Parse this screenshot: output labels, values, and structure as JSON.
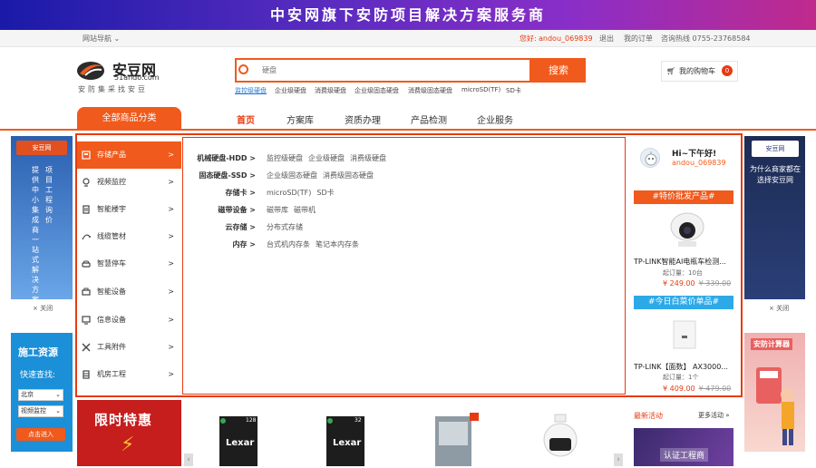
{
  "banner": {
    "text": "中安网旗下安防项目解决方案服务商"
  },
  "topbar": {
    "site_nav": "网站导航",
    "greeting": "您好:",
    "username": "andou_069839",
    "logout": "退出",
    "my_orders": "我的订单",
    "hotline": "咨询热线 0755-23768584"
  },
  "logo": {
    "cn": "安豆网",
    "en": "51ando.com",
    "slogan": "安防集采找安豆"
  },
  "search": {
    "placeholder": "硬盘",
    "button": "搜索",
    "hot_keywords": [
      "监控级硬盘",
      "企业级硬盘",
      "消费级硬盘",
      "企业级固态硬盘",
      "消费级固态硬盘",
      "microSD(TF)",
      "SD卡"
    ]
  },
  "cart": {
    "label": "我的购物车",
    "count": "0"
  },
  "nav": {
    "all_categories": "全部商品分类",
    "items": [
      "首页",
      "方案库",
      "资质办理",
      "产品检测",
      "企业服务"
    ]
  },
  "categories": [
    "存储产品",
    "视频监控",
    "智能楼宇",
    "线缆管材",
    "智慧停车",
    "智能设备",
    "信息设备",
    "工具附件",
    "机房工程"
  ],
  "subcategories": [
    {
      "name": "机械硬盘-HDD >",
      "links": [
        "监控级硬盘",
        "企业级硬盘",
        "消费级硬盘"
      ]
    },
    {
      "name": "固态硬盘-SSD >",
      "links": [
        "企业级固态硬盘",
        "消费级固态硬盘"
      ]
    },
    {
      "name": "存储卡 >",
      "links": [
        "microSD(TF)",
        "SD卡"
      ]
    },
    {
      "name": "磁带设备 >",
      "links": [
        "磁带库",
        "磁带机"
      ]
    },
    {
      "name": "云存储 >",
      "links": [
        "分布式存储"
      ]
    },
    {
      "name": "内存 >",
      "links": [
        "台式机内存条",
        "笔记本内存条"
      ]
    }
  ],
  "user_panel": {
    "greeting": "Hi~下午好!",
    "username": "andou_069839"
  },
  "promo1": {
    "title": "#特价批发产品#",
    "name": "TP-LINK智能AI电瓶车检测...",
    "meta": "起订量：10台",
    "price": "¥ 249.00",
    "old_price": "¥ 339.00"
  },
  "promo2": {
    "title": "#今日白菜价单品#",
    "name": "TP-LINK【面数】 AX3000...",
    "meta": "起订量：1个",
    "price": "¥ 409.00",
    "old_price": "¥ 479.00"
  },
  "ad_left": {
    "logo": "安豆网",
    "col1": "提供中小集成商一站式解决方案",
    "col2": "项目工程询价",
    "close": "× 关闭"
  },
  "ad_right": {
    "logo": "安豆网",
    "text": "为什么商家都在选择安豆网",
    "close": "× 关闭"
  },
  "ad_resource": {
    "title": "施工资源",
    "subtitle": "快速查找:",
    "select1": "北京",
    "select2": "视频监控",
    "button": "点击进入"
  },
  "ad_calc": {
    "title": "安防计算器"
  },
  "deal": {
    "title": "限时特惠"
  },
  "bottom_products": [
    {
      "brand": "Lexar",
      "cap": "128"
    },
    {
      "brand": "Lexar",
      "cap": "32"
    }
  ],
  "news": {
    "title": "最新活动",
    "more": "更多活动 »",
    "banner": "认证工程商"
  },
  "colors": {
    "accent": "#f05a1c",
    "red": "#e63b12",
    "blue": "#2ea9e8"
  }
}
